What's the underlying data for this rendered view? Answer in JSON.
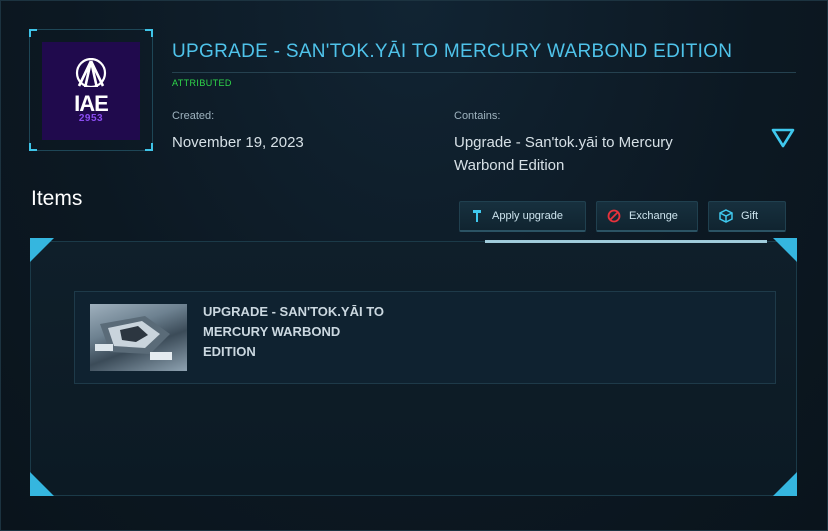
{
  "header": {
    "title": "UPGRADE - SAN'TOK.YĀI TO MERCURY WARBOND EDITION",
    "status": "ATTRIBUTED",
    "created_label": "Created:",
    "created_value": "November 19, 2023",
    "contains_label": "Contains:",
    "contains_value_line1": "Upgrade - San'tok.yāi to Mercury",
    "contains_value_line2": "Warbond Edition"
  },
  "logo": {
    "main_text": "IAE",
    "year_text": "2953",
    "background": "#200a4d"
  },
  "items": {
    "heading": "Items"
  },
  "actions": {
    "apply_label": "Apply upgrade",
    "exchange_label": "Exchange",
    "gift_label": "Gift"
  },
  "item_card": {
    "line1": "UPGRADE - SAN'TOK.YĀI TO",
    "line2": "MERCURY WARBOND",
    "line3": "EDITION"
  },
  "colors": {
    "accent": "#4fc3ea",
    "status": "#2fd84a",
    "exchange_icon": "#e8323c"
  },
  "icons": [
    "expand-chevron-icon",
    "apply-upgrade-icon",
    "exchange-icon",
    "gift-icon"
  ]
}
